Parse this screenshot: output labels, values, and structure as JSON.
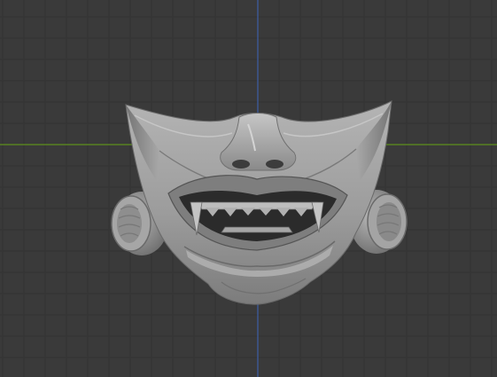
{
  "viewport": {
    "background": "#3a3a3a",
    "grid_color": "#333333",
    "grid_major_color": "#2e2e2e",
    "x_axis_color": "#5e8f1c",
    "z_axis_color": "#3d5fa6"
  },
  "model": {
    "name_icon": "oni-mask-icon",
    "base_color": "#a2a2a2",
    "shadow_color": "#5a5a5a",
    "highlight_color": "#c8c8c8",
    "dark_color": "#2a2a2a"
  }
}
